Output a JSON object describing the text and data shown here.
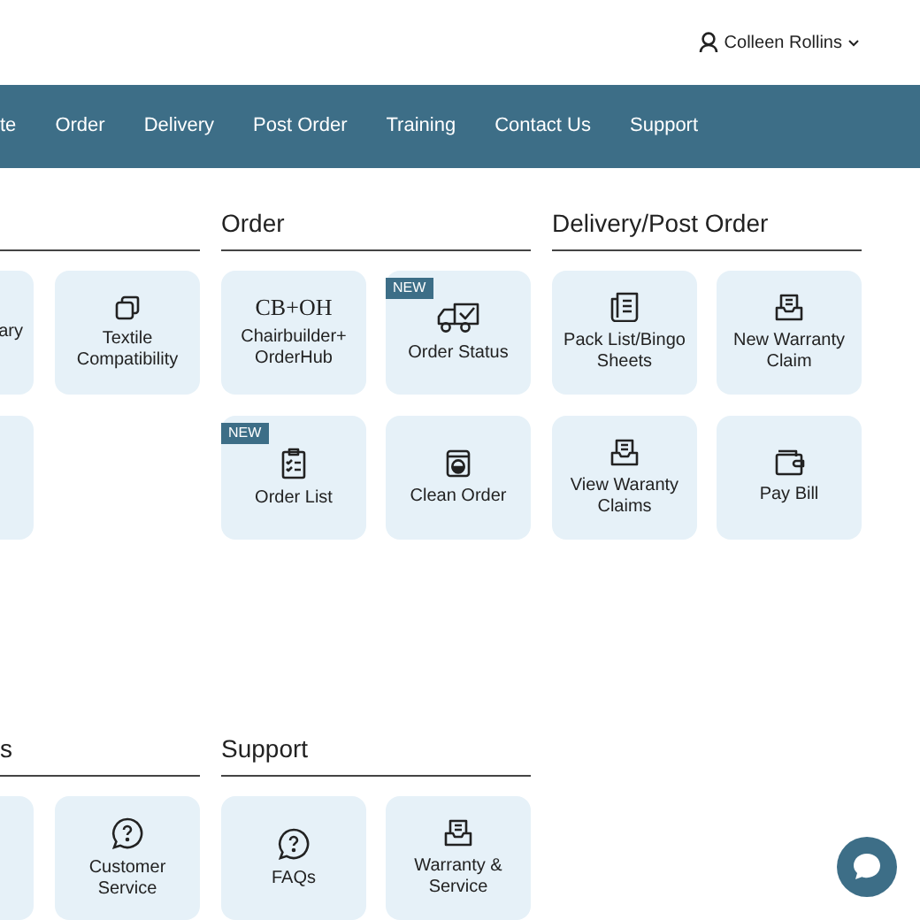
{
  "user_menu": {
    "name": "Colleen Rollins"
  },
  "nav": [
    {
      "label": "te"
    },
    {
      "label": "Order"
    },
    {
      "label": "Delivery"
    },
    {
      "label": "Post Order"
    },
    {
      "label": "Training"
    },
    {
      "label": "Contact Us"
    },
    {
      "label": "Support"
    }
  ],
  "section_rows": [
    {
      "sections": [
        {
          "tiles": [
            {
              "kind": "empty",
              "label": "ary",
              "new": false
            },
            {
              "kind": "stack",
              "label": "Textile Compatibility",
              "new": false
            },
            {
              "kind": "empty",
              "new": false
            }
          ]
        },
        {
          "title": "Order",
          "tiles": [
            {
              "kind": "text",
              "logo_text": "CB+OH",
              "label": "Chairbuilder+ OrderHub",
              "new": false
            },
            {
              "kind": "truck",
              "label": "Order Status",
              "new": true,
              "badge": "NEW"
            },
            {
              "kind": "checklist",
              "label": "Order List",
              "new": true,
              "badge": "NEW"
            },
            {
              "kind": "washer",
              "label": "Clean Order",
              "new": false
            }
          ]
        },
        {
          "title": "Delivery/Post Order",
          "tiles": [
            {
              "kind": "document",
              "label": "Pack List/Bingo Sheets",
              "new": false
            },
            {
              "kind": "inbox",
              "label": "New Warranty Claim",
              "new": false
            },
            {
              "kind": "inbox",
              "label": "View Waranty Claims",
              "new": false
            },
            {
              "kind": "wallet",
              "label": "Pay Bill",
              "new": false
            }
          ]
        }
      ]
    },
    {
      "sections": [
        {
          "title": "s",
          "tiles": [
            {
              "kind": "empty",
              "new": false
            },
            {
              "kind": "question",
              "label": "Customer Service",
              "new": false
            }
          ]
        },
        {
          "title": "Support",
          "tiles": [
            {
              "kind": "question",
              "label": "FAQs",
              "new": false
            },
            {
              "kind": "inbox",
              "label": "Warranty & Service",
              "new": false
            }
          ]
        }
      ]
    }
  ]
}
